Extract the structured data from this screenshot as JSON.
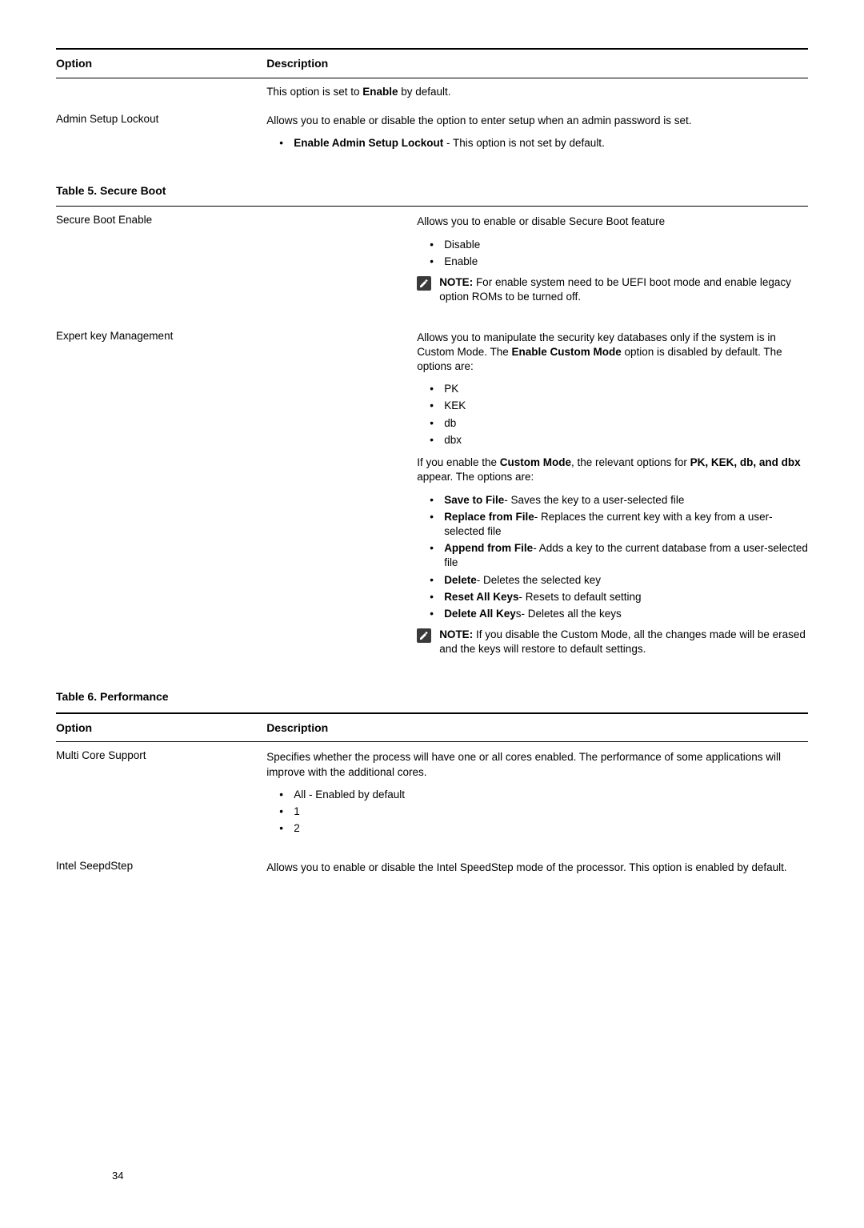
{
  "table4": {
    "header_option": "Option",
    "header_desc": "Description",
    "prev_trailing": "This option is set to <b>Enable</b> by default.",
    "admin_setup_lockout": {
      "label": "Admin Setup Lockout",
      "desc": "Allows you to enable or disable the option to enter setup when an admin password is set.",
      "bullet": "<b>Enable Admin Setup Lockout</b> - This option is not set by default."
    }
  },
  "table5": {
    "title": "Table 5. Secure Boot",
    "secure_boot_enable": {
      "label": "Secure Boot Enable",
      "desc": "Allows you to enable or disable Secure Boot feature",
      "opts": [
        "Disable",
        "Enable"
      ],
      "note": "<b>NOTE:</b> For enable system need to be UEFI boot mode and enable legacy option ROMs to be turned off."
    },
    "expert_key_mgmt": {
      "label": "Expert key Management",
      "desc": "Allows you to manipulate the security key databases only if the system is in Custom Mode. The <b>Enable Custom Mode</b> option is disabled by default. The options are:",
      "opts1": [
        "PK",
        "KEK",
        "db",
        "dbx"
      ],
      "mid": "If you enable the <b>Custom Mode</b>, the relevant options for <b>PK, KEK, db, and dbx</b> appear. The options are:",
      "opts2": [
        "<b>Save to File</b>- Saves the key to a user-selected file",
        "<b>Replace from File</b>- Replaces the current key with a key from a user-selected file",
        "<b>Append from File</b>- Adds a key to the current database from a user-selected file",
        "<b>Delete</b>- Deletes the selected key",
        "<b>Reset All Keys</b>- Resets to default setting",
        "<b>Delete All Key</b>s- Deletes all the keys"
      ],
      "note": "<b>NOTE:</b> If you disable the Custom Mode, all the changes made will be erased and the keys will restore to default settings."
    }
  },
  "table6": {
    "title": "Table 6. Performance",
    "header_option": "Option",
    "header_desc": "Description",
    "multi_core": {
      "label": "Multi Core Support",
      "desc": "Specifies whether the process will have one or all cores enabled. The performance of some applications will improve with the additional cores.",
      "opts": [
        "All - Enabled by default",
        "1",
        "2"
      ]
    },
    "speedstep": {
      "label": "Intel SeepdStep",
      "desc": "Allows you to enable or disable the Intel SpeedStep mode of the processor. This option is enabled by default."
    }
  },
  "page_number": "34"
}
